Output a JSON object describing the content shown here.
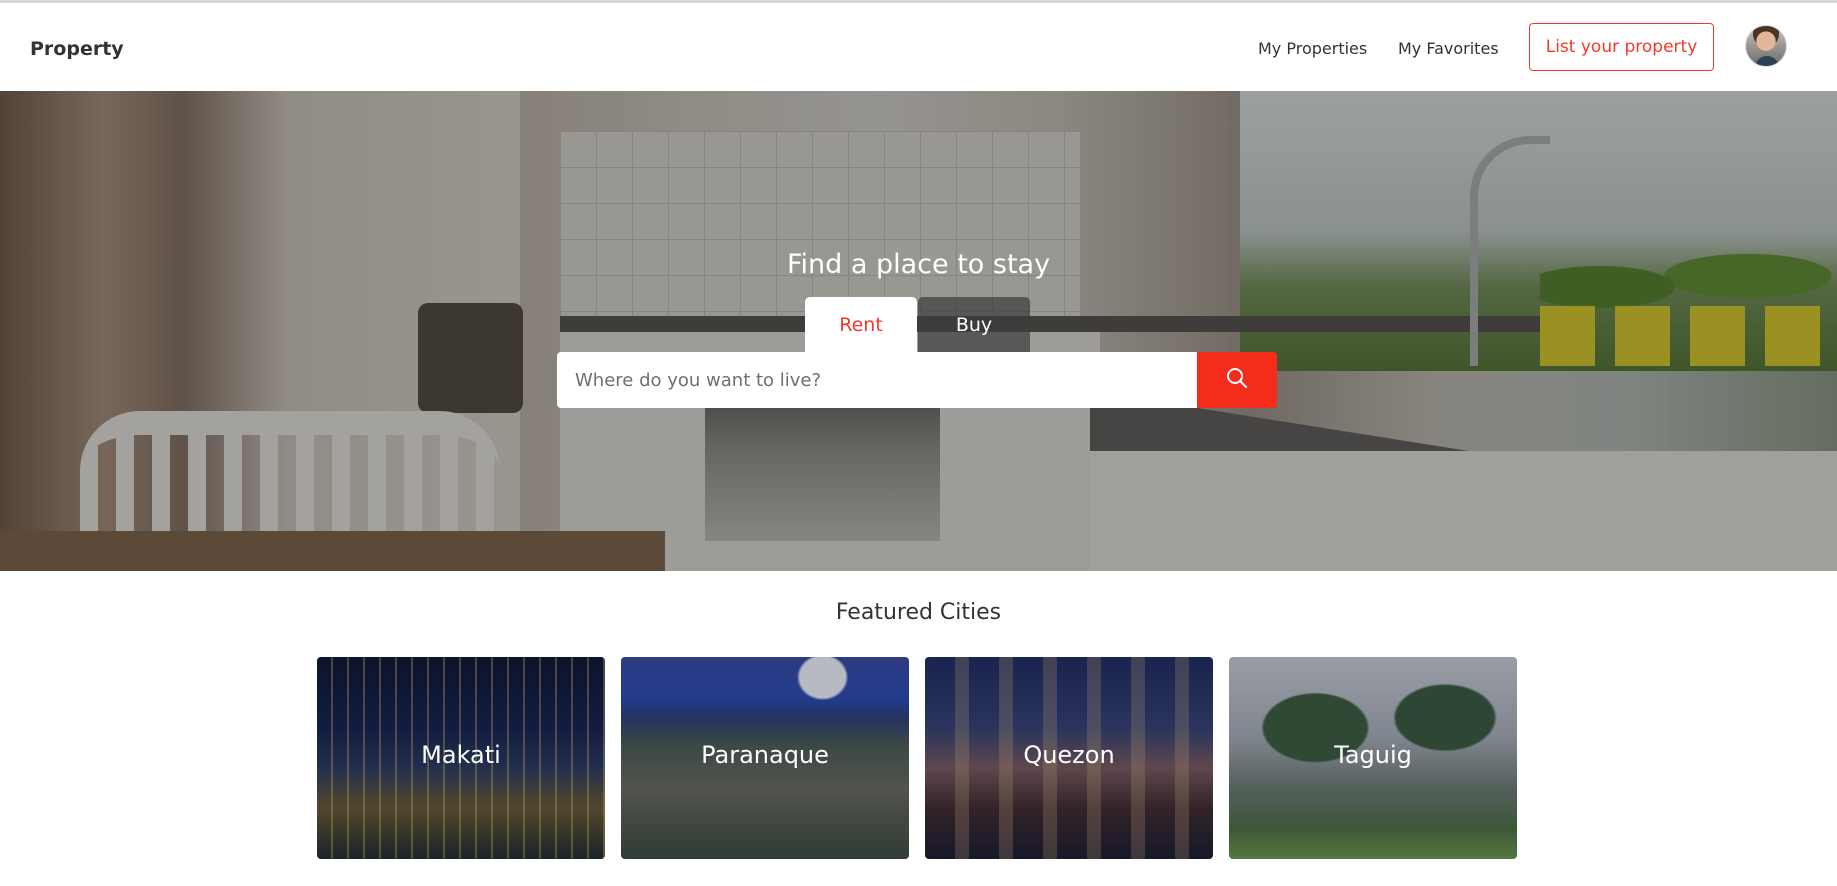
{
  "header": {
    "brand": "Property",
    "nav": {
      "my_properties": "My Properties",
      "my_favorites": "My Favorites",
      "list_property": "List your property"
    },
    "avatar_icon": "user-avatar"
  },
  "hero": {
    "title": "Find a place to stay",
    "tabs": {
      "rent": "Rent",
      "buy": "Buy",
      "active": "Rent"
    },
    "search": {
      "placeholder": "Where do you want to live?",
      "value": "",
      "icon": "search-icon"
    }
  },
  "featured": {
    "title": "Featured Cities",
    "cities": [
      "Makati",
      "Paranaque",
      "Quezon",
      "Taguig"
    ]
  },
  "colors": {
    "accent": "#f23a2c",
    "search_button": "#f52c1c",
    "text": "#333333"
  }
}
